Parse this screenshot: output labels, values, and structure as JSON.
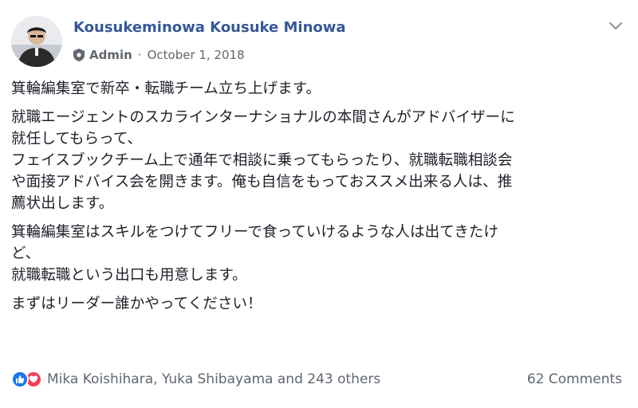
{
  "post": {
    "author": "Kousukeminowa Kousuke Minowa",
    "role": "Admin",
    "separator": "·",
    "date": "October 1, 2018",
    "paragraphs": [
      [
        "箕輪編集室で新卒・転職チーム立ち上げます。"
      ],
      [
        "就職エージェントのスカラインターナショナルの本間さんがアドバイザーに",
        "就任してもらって、",
        "フェイスブックチーム上で通年で相談に乗ってもらったり、就職転職相談会",
        "や面接アドバイス会を開きます。俺も自信をもっておススメ出来る人は、推",
        "薦状出します。"
      ],
      [
        "箕輪編集室はスキルをつけてフリーで食っていけるような人は出てきたけ",
        "ど、",
        "就職転職という出口も用意します。"
      ],
      [
        "まずはリーダー誰かやってください！"
      ]
    ]
  },
  "footer": {
    "reactors": "Mika Koishihara, Yuka Shibayama and 243 others",
    "comments": "62 Comments"
  },
  "icons": {
    "avatar": "profile-photo",
    "role_icon": "shield-icon",
    "menu": "chevron-down-icon",
    "reactions": [
      "like-icon",
      "love-icon"
    ]
  },
  "colors": {
    "author_link": "#365899",
    "meta_text": "#606770",
    "body_text": "#1d2129",
    "like": "#1877f2",
    "love": "#f33e58"
  }
}
